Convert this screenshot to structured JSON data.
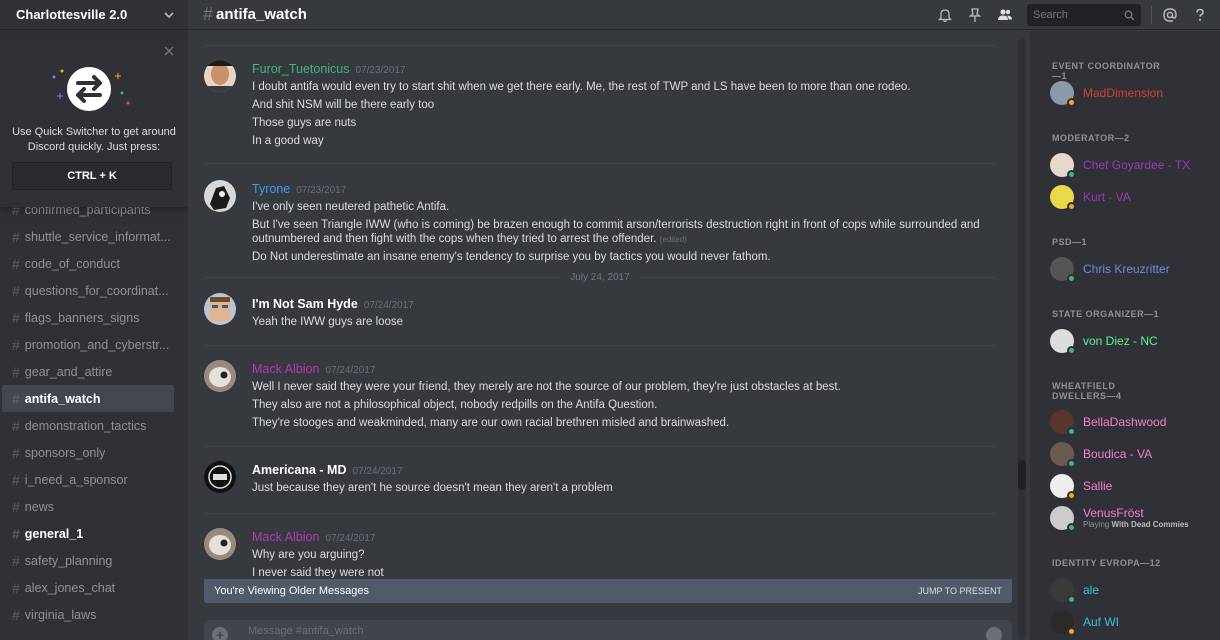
{
  "server": {
    "name": "Charlottesville 2.0"
  },
  "quick_switcher": {
    "text": "Use Quick Switcher to get around Discord quickly. Just press:",
    "shortcut": "CTRL + K"
  },
  "channels": [
    {
      "name": "confirmed_participants"
    },
    {
      "name": "shuttle_service_informat..."
    },
    {
      "name": "code_of_conduct"
    },
    {
      "name": "questions_for_coordinat..."
    },
    {
      "name": "flags_banners_signs"
    },
    {
      "name": "promotion_and_cyberstr..."
    },
    {
      "name": "gear_and_attire"
    },
    {
      "name": "antifa_watch"
    },
    {
      "name": "demonstration_tactics"
    },
    {
      "name": "sponsors_only"
    },
    {
      "name": "i_need_a_sponsor"
    },
    {
      "name": "news"
    },
    {
      "name": "general_1"
    },
    {
      "name": "safety_planning"
    },
    {
      "name": "alex_jones_chat"
    },
    {
      "name": "virginia_laws"
    }
  ],
  "header": {
    "channel": "antifa_watch",
    "search_placeholder": "Search"
  },
  "messages": [
    {
      "author": "Furor_Tuetonicus",
      "color": "#43b581",
      "timestamp": "07/23/2017",
      "lines": [
        "I doubt antifa would even try to start shit when we get there early. Me, the rest of TWP and LS have been to more than one rodeo.",
        "And shit NSM will be there early too",
        "Those guys are nuts",
        "In a good way"
      ]
    },
    {
      "author": "Tyrone",
      "color": "#3e9ef2",
      "timestamp": "07/23/2017",
      "lines": [
        "I've only seen neutered pathetic Antifa.",
        "But I've seen Triangle IWW (who is coming) be brazen enough to commit arson/terrorists destruction right in front of cops while surrounded and",
        "outnumbered and then fight with the cops when they tried to arrest the offender.",
        "Do Not underestimate an insane enemy's tendency to surprise you by tactics you would never fathom."
      ],
      "edited": "(edited)"
    },
    {
      "author": "I'm Not Sam Hyde",
      "color": "#ffffff",
      "timestamp": "07/24/2017",
      "lines": [
        "Yeah the IWW guys are loose"
      ]
    },
    {
      "author": "Mack Albion",
      "color": "#b23ab8",
      "timestamp": "07/24/2017",
      "lines": [
        "Well I never said they were your friend, they merely are not the source of our problem, they're just obstacles at best.",
        "They also are not a philosophical object, nobody redpills on the Antifa Question.",
        "They're stooges and weakminded, many are our own racial brethren misled and brainwashed."
      ]
    },
    {
      "author": "Americana - MD",
      "color": "#ffffff",
      "timestamp": "07/24/2017",
      "lines": [
        "Just because they aren't he source doesn't mean they aren't a problem"
      ]
    },
    {
      "author": "Mack Albion",
      "color": "#b23ab8",
      "timestamp": "07/24/2017",
      "lines": [
        "Why are you arguing?",
        "I never said they were not"
      ]
    }
  ],
  "date_divider": "July 24, 2017",
  "older_bar": {
    "text": "You're Viewing Older Messages",
    "jump": "JUMP TO PRESENT"
  },
  "composer": {
    "placeholder": "Message #antifa_watch"
  },
  "member_roles": [
    {
      "title": "EVENT COORDINATOR—1",
      "members": [
        {
          "name": "MadDimension",
          "color": "#d0452f",
          "status": "#faa61a"
        }
      ]
    },
    {
      "title": "MODERATOR—2",
      "members": [
        {
          "name": "Chef Goyardee - TX",
          "color": "#9b3ab8",
          "status": "#43b581"
        },
        {
          "name": "Kurt - VA",
          "color": "#9b3ab8",
          "status": "#faa61a"
        }
      ]
    },
    {
      "title": "PSD—1",
      "members": [
        {
          "name": "Chris Kreuzritter",
          "color": "#7289da",
          "status": "#43b581"
        }
      ]
    },
    {
      "title": "STATE ORGANIZER—1",
      "members": [
        {
          "name": "von Diez - NC",
          "color": "#63f08b",
          "status": "#43b581"
        }
      ]
    },
    {
      "title": "WHEATFIELD DWELLERS—4",
      "members": [
        {
          "name": "BellaDashwood",
          "color": "#f47fce",
          "status": "#43b581"
        },
        {
          "name": "Boudica - VA",
          "color": "#f47fce",
          "status": "#43b581"
        },
        {
          "name": "Sallie",
          "color": "#f47fce",
          "status": "#faa61a"
        },
        {
          "name": "VenusFröst",
          "color": "#f47fce",
          "status": "#43b581",
          "activity_prefix": "Playing",
          "activity": "With Dead Commies"
        }
      ]
    },
    {
      "title": "IDENTITY EVROPA—12",
      "members": [
        {
          "name": "ale",
          "color": "#3ec1d3",
          "status": "#43b581"
        },
        {
          "name": "Auf WI",
          "color": "#3ec1d3",
          "status": "#faa61a"
        }
      ]
    }
  ]
}
